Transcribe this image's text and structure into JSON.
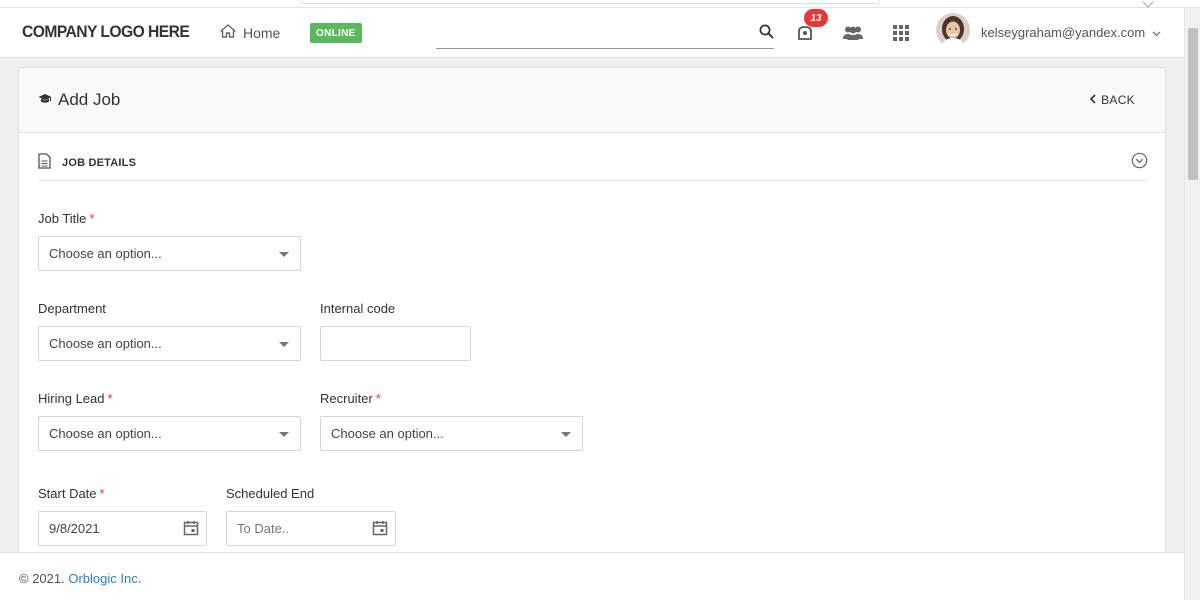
{
  "header": {
    "logo_text": "COMPANY LOGO HERE",
    "home_label": "Home",
    "status_badge": "ONLINE",
    "status_color": "#5cb85c",
    "search_placeholder": "",
    "notification_count": "13",
    "user_email": "kelseygraham@yandex.com",
    "icons": [
      "home-icon",
      "search-icon",
      "notification-icon",
      "users-icon",
      "apps-grid-icon",
      "chevron-down-icon"
    ]
  },
  "page": {
    "title": "Add Job",
    "back_label": "BACK",
    "section_title": "JOB DETAILS"
  },
  "form": {
    "job_title": {
      "label": "Job Title",
      "required": "*",
      "value": "Choose an option..."
    },
    "department": {
      "label": "Department",
      "value": "Choose an option..."
    },
    "internal_code": {
      "label": "Internal code",
      "value": ""
    },
    "hiring_lead": {
      "label": "Hiring Lead",
      "required": "*",
      "value": "Choose an option..."
    },
    "recruiter": {
      "label": "Recruiter",
      "required": "*",
      "value": "Choose an option..."
    },
    "start_date": {
      "label": "Start Date",
      "required": "*",
      "value": "9/8/2021"
    },
    "scheduled_end": {
      "label": "Scheduled End",
      "placeholder": "To Date.."
    }
  },
  "footer": {
    "copyright": "© 2021. ",
    "company_link": "Orblogic Inc."
  },
  "colors": {
    "accent_link": "#2a7fd4",
    "badge_red": "#e53935",
    "required": "#e53935"
  }
}
